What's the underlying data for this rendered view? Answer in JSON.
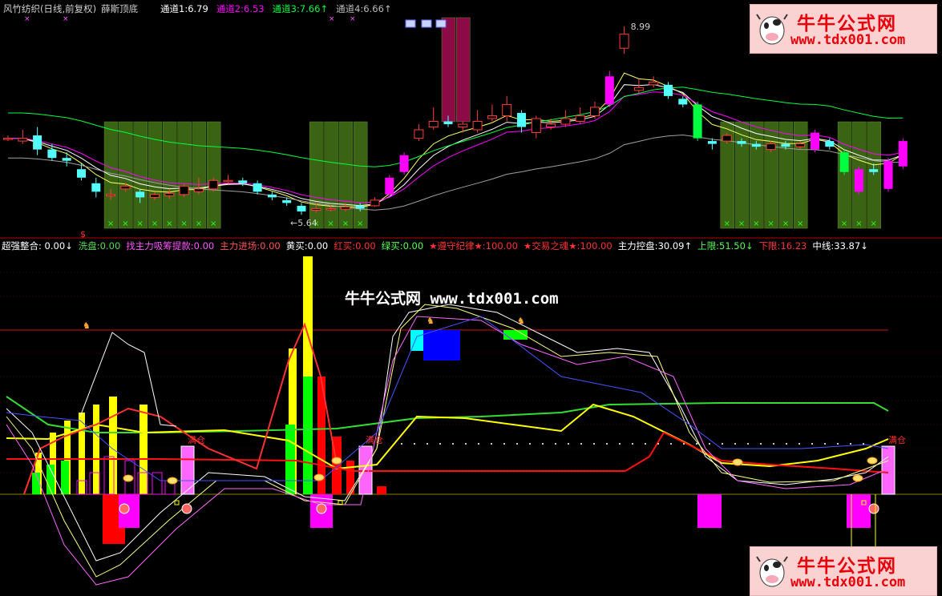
{
  "colors": {
    "background": "#000000",
    "up_candle": "#ff3c3c",
    "down_candle_cyan": "#54ffff",
    "down_candle_green": "#00ff40",
    "magenta": "#ff00ff",
    "olive_block": "#3a6414",
    "maroon_block": "#8c0a46",
    "yellow": "#ffff00",
    "white": "#ffffff",
    "red": "#ff0000"
  },
  "top_panel": {
    "title_parts": [
      "风竹纺织(日线,前复权)",
      "薛斯顶底"
    ],
    "legend": [
      {
        "label": "通道1:",
        "value": "6.79",
        "color": "#ffffff"
      },
      {
        "label": "通道2:",
        "value": "6.53",
        "color": "#ff00ff"
      },
      {
        "label": "通道3:",
        "value": "7.66",
        "color": "#00ff40",
        "arrow": "↑"
      },
      {
        "label": "通道4:",
        "value": "6.66",
        "color": "#bbbbbb",
        "arrow": "↑"
      }
    ],
    "high_label": "8.99",
    "low_label": "5.64",
    "low_marker": "$"
  },
  "bottom_panel": {
    "legend": [
      {
        "label": "超强整合",
        "value": ": 0.00",
        "color": "#ffffff",
        "arrow": "↓"
      },
      {
        "label": "洗盘:",
        "value": "0.00",
        "color": "#55dd55"
      },
      {
        "label": "找主力吸筹提款:",
        "value": "0.00",
        "color": "#ff55ff"
      },
      {
        "label": "主力进场:",
        "value": "0.00",
        "color": "#ff5555"
      },
      {
        "label": "黄买:",
        "value": "0.00",
        "color": "#ffffff"
      },
      {
        "label": "红买:",
        "value": "0.00",
        "color": "#ff3333"
      },
      {
        "label": "绿买:",
        "value": "0.00",
        "color": "#55ff55"
      },
      {
        "label": "★遵守纪律★:",
        "value": "100.00",
        "color": "#ff3333"
      },
      {
        "label": "★交易之魂★:",
        "value": "100.00",
        "color": "#ff3333"
      },
      {
        "label": "主力控盘:",
        "value": "30.09",
        "color": "#ffffff",
        "arrow": "↑"
      },
      {
        "label": "上限:",
        "value": "51.50",
        "color": "#55ff55",
        "arrow": "↓"
      },
      {
        "label": "下限:",
        "value": "16.23",
        "color": "#ff3333"
      },
      {
        "label": "中线:",
        "value": "33.87",
        "color": "#ffffff",
        "arrow": "↓"
      }
    ],
    "position_label": "满仓"
  },
  "watermark": "牛牛公式网 www.tdx001.com",
  "logo": {
    "title": "牛牛公式网",
    "url": "www.tdx001.com"
  },
  "chart_data": [
    {
      "type": "candlestick",
      "title": "风竹纺织(日线,前复权) 薛斯顶底",
      "annotations": {
        "high": 8.99,
        "low": 5.64
      },
      "candles": [
        {
          "o": 7.0,
          "c": 7.0,
          "h": 7.05,
          "l": 6.95
        },
        {
          "o": 6.95,
          "c": 7.0,
          "h": 7.15,
          "l": 6.9
        },
        {
          "o": 7.05,
          "c": 6.8,
          "h": 7.2,
          "l": 6.7
        },
        {
          "o": 6.8,
          "c": 6.65,
          "h": 6.9,
          "l": 6.6
        },
        {
          "o": 6.65,
          "c": 6.6,
          "h": 6.75,
          "l": 6.5
        },
        {
          "o": 6.45,
          "c": 6.3,
          "h": 6.55,
          "l": 6.25
        },
        {
          "o": 6.2,
          "c": 6.05,
          "h": 6.3,
          "l": 5.95
        },
        {
          "o": 6.0,
          "c": 6.0,
          "h": 6.1,
          "l": 5.9
        },
        {
          "o": 6.1,
          "c": 6.15,
          "h": 6.2,
          "l": 6.05
        },
        {
          "o": 6.05,
          "c": 5.95,
          "h": 6.1,
          "l": 5.85
        },
        {
          "o": 5.95,
          "c": 6.0,
          "h": 6.05,
          "l": 5.9
        },
        {
          "o": 5.98,
          "c": 6.02,
          "h": 6.1,
          "l": 5.92
        },
        {
          "o": 6.0,
          "c": 6.15,
          "h": 6.2,
          "l": 5.95
        },
        {
          "o": 6.05,
          "c": 6.1,
          "h": 6.3,
          "l": 6.0
        },
        {
          "o": 6.1,
          "c": 6.25,
          "h": 6.3,
          "l": 6.05
        },
        {
          "o": 6.25,
          "c": 6.25,
          "h": 6.35,
          "l": 6.2
        },
        {
          "o": 6.25,
          "c": 6.2,
          "h": 6.3,
          "l": 6.15
        },
        {
          "o": 6.2,
          "c": 6.05,
          "h": 6.25,
          "l": 6.0
        },
        {
          "o": 6.0,
          "c": 5.95,
          "h": 6.05,
          "l": 5.9
        },
        {
          "o": 5.9,
          "c": 5.85,
          "h": 5.95,
          "l": 5.8
        },
        {
          "o": 5.8,
          "c": 5.7,
          "h": 5.85,
          "l": 5.64
        },
        {
          "o": 5.72,
          "c": 5.75,
          "h": 5.85,
          "l": 5.68
        },
        {
          "o": 5.75,
          "c": 5.75,
          "h": 5.8,
          "l": 5.7
        },
        {
          "o": 5.74,
          "c": 5.78,
          "h": 5.85,
          "l": 5.7
        },
        {
          "o": 5.8,
          "c": 5.75,
          "h": 5.85,
          "l": 5.7
        },
        {
          "o": 5.8,
          "c": 5.9,
          "h": 5.95,
          "l": 5.78
        },
        {
          "o": 6.0,
          "c": 6.3,
          "h": 6.35,
          "l": 5.95
        },
        {
          "o": 6.4,
          "c": 6.7,
          "h": 6.75,
          "l": 6.35
        },
        {
          "o": 7.0,
          "c": 7.15,
          "h": 7.25,
          "l": 6.95
        },
        {
          "o": 7.2,
          "c": 7.3,
          "h": 7.55,
          "l": 7.15
        },
        {
          "o": 7.3,
          "c": 7.25,
          "h": 7.4,
          "l": 7.2
        },
        {
          "o": 7.2,
          "c": 7.25,
          "h": 7.3,
          "l": 7.1
        },
        {
          "o": 7.15,
          "c": 7.3,
          "h": 7.5,
          "l": 7.1
        },
        {
          "o": 7.35,
          "c": 7.4,
          "h": 7.6,
          "l": 7.3
        },
        {
          "o": 7.4,
          "c": 7.6,
          "h": 7.75,
          "l": 7.3
        },
        {
          "o": 7.45,
          "c": 7.2,
          "h": 7.5,
          "l": 7.1
        },
        {
          "o": 7.1,
          "c": 7.35,
          "h": 7.4,
          "l": 7.0
        },
        {
          "o": 7.2,
          "c": 7.25,
          "h": 7.35,
          "l": 7.15
        },
        {
          "o": 7.25,
          "c": 7.35,
          "h": 7.5,
          "l": 7.2
        },
        {
          "o": 7.3,
          "c": 7.4,
          "h": 7.55,
          "l": 7.25
        },
        {
          "o": 7.4,
          "c": 7.55,
          "h": 7.65,
          "l": 7.35
        },
        {
          "o": 7.6,
          "c": 8.1,
          "h": 8.2,
          "l": 7.55
        },
        {
          "o": 8.6,
          "c": 8.85,
          "h": 8.99,
          "l": 8.5
        },
        {
          "o": 7.85,
          "c": 7.9,
          "h": 8.05,
          "l": 7.8
        },
        {
          "o": 7.95,
          "c": 8.0,
          "h": 8.1,
          "l": 7.9
        },
        {
          "o": 7.95,
          "c": 7.75,
          "h": 8.0,
          "l": 7.7
        },
        {
          "o": 7.7,
          "c": 7.6,
          "h": 7.75,
          "l": 7.55
        },
        {
          "o": 7.6,
          "c": 7.0,
          "h": 7.65,
          "l": 6.95
        },
        {
          "o": 6.95,
          "c": 6.9,
          "h": 7.0,
          "l": 6.8
        },
        {
          "o": 6.95,
          "c": 7.05,
          "h": 7.1,
          "l": 6.9
        },
        {
          "o": 6.95,
          "c": 6.9,
          "h": 7.0,
          "l": 6.85
        },
        {
          "o": 6.9,
          "c": 6.85,
          "h": 6.95,
          "l": 6.8
        },
        {
          "o": 6.8,
          "c": 6.9,
          "h": 6.95,
          "l": 6.75
        },
        {
          "o": 6.9,
          "c": 6.85,
          "h": 6.95,
          "l": 6.8
        },
        {
          "o": 6.85,
          "c": 6.9,
          "h": 6.95,
          "l": 6.8
        },
        {
          "o": 6.8,
          "c": 7.1,
          "h": 7.15,
          "l": 6.75
        },
        {
          "o": 6.95,
          "c": 6.85,
          "h": 7.0,
          "l": 6.8
        },
        {
          "o": 6.75,
          "c": 6.4,
          "h": 6.8,
          "l": 6.35
        },
        {
          "o": 6.05,
          "c": 6.45,
          "h": 6.5,
          "l": 6.0
        },
        {
          "o": 6.45,
          "c": 6.4,
          "h": 6.55,
          "l": 6.35
        },
        {
          "o": 6.1,
          "c": 6.6,
          "h": 6.65,
          "l": 6.05
        },
        {
          "o": 6.5,
          "c": 6.95,
          "h": 7.0,
          "l": 6.45
        }
      ]
    },
    {
      "type": "line",
      "title": "超强整合",
      "legend": [
        "超强整合",
        "洗盘",
        "找主力吸筹提款",
        "主力进场",
        "黄买",
        "红买",
        "绿买",
        "★遵守纪律★",
        "★交易之魂★",
        "主力控盘",
        "上限",
        "下限",
        "中线"
      ],
      "values": {
        "超强整合": 0.0,
        "洗盘": 0.0,
        "找主力吸筹提款": 0.0,
        "主力进场": 0.0,
        "黄买": 0.0,
        "红买": 0.0,
        "绿买": 0.0,
        "★遵守纪律★": 100.0,
        "★交易之魂★": 100.0,
        "主力控盘": 30.09,
        "上限": 51.5,
        "下限": 16.23,
        "中线": 33.87
      }
    }
  ]
}
